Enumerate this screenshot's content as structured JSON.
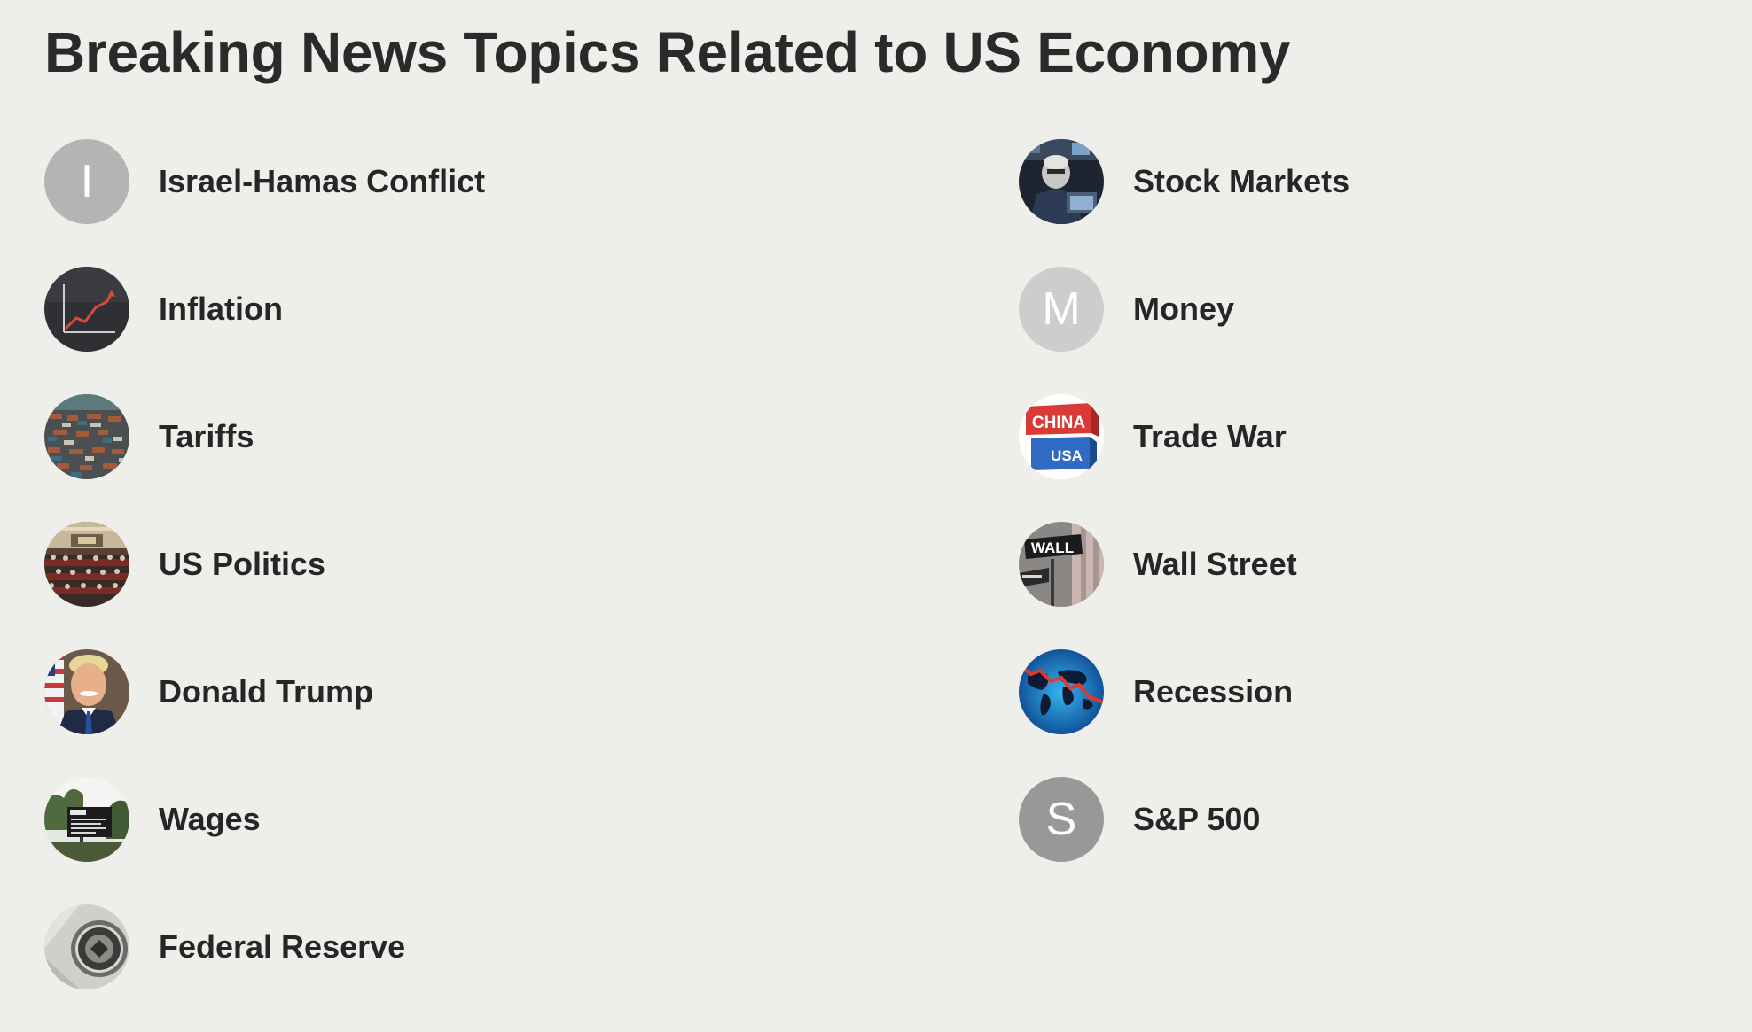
{
  "title": "Breaking News Topics Related to US Economy",
  "colors": {
    "background": "#eeeeea",
    "text": "#262626"
  },
  "topics_left": [
    {
      "label": "Israel-Hamas Conflict",
      "avatar": {
        "type": "letter",
        "letter": "I",
        "color": "#b4b4b4"
      }
    },
    {
      "label": "Inflation",
      "avatar": {
        "type": "image",
        "icon": "rising-chart-icon"
      }
    },
    {
      "label": "Tariffs",
      "avatar": {
        "type": "image",
        "icon": "shipping-port-icon"
      }
    },
    {
      "label": "US Politics",
      "avatar": {
        "type": "image",
        "icon": "congress-chamber-icon"
      }
    },
    {
      "label": "Donald Trump",
      "avatar": {
        "type": "image",
        "icon": "portrait-icon"
      }
    },
    {
      "label": "Wages",
      "avatar": {
        "type": "image",
        "icon": "hiring-sign-icon"
      }
    },
    {
      "label": "Federal Reserve",
      "avatar": {
        "type": "image",
        "icon": "federal-reserve-seal-icon"
      }
    }
  ],
  "topics_right": [
    {
      "label": "Stock Markets",
      "avatar": {
        "type": "image",
        "icon": "trader-icon"
      }
    },
    {
      "label": "Money",
      "avatar": {
        "type": "letter",
        "letter": "M",
        "color": "#cdcdcd"
      }
    },
    {
      "label": "Trade War",
      "avatar": {
        "type": "image",
        "icon": "china-usa-blocks-icon",
        "text_top": "CHINA",
        "text_bottom": "USA"
      }
    },
    {
      "label": "Wall Street",
      "avatar": {
        "type": "image",
        "icon": "wall-street-sign-icon",
        "text": "WALL"
      }
    },
    {
      "label": "Recession",
      "avatar": {
        "type": "image",
        "icon": "world-map-decline-icon"
      }
    },
    {
      "label": "S&P 500",
      "avatar": {
        "type": "letter",
        "letter": "S",
        "color": "#989898"
      }
    }
  ]
}
